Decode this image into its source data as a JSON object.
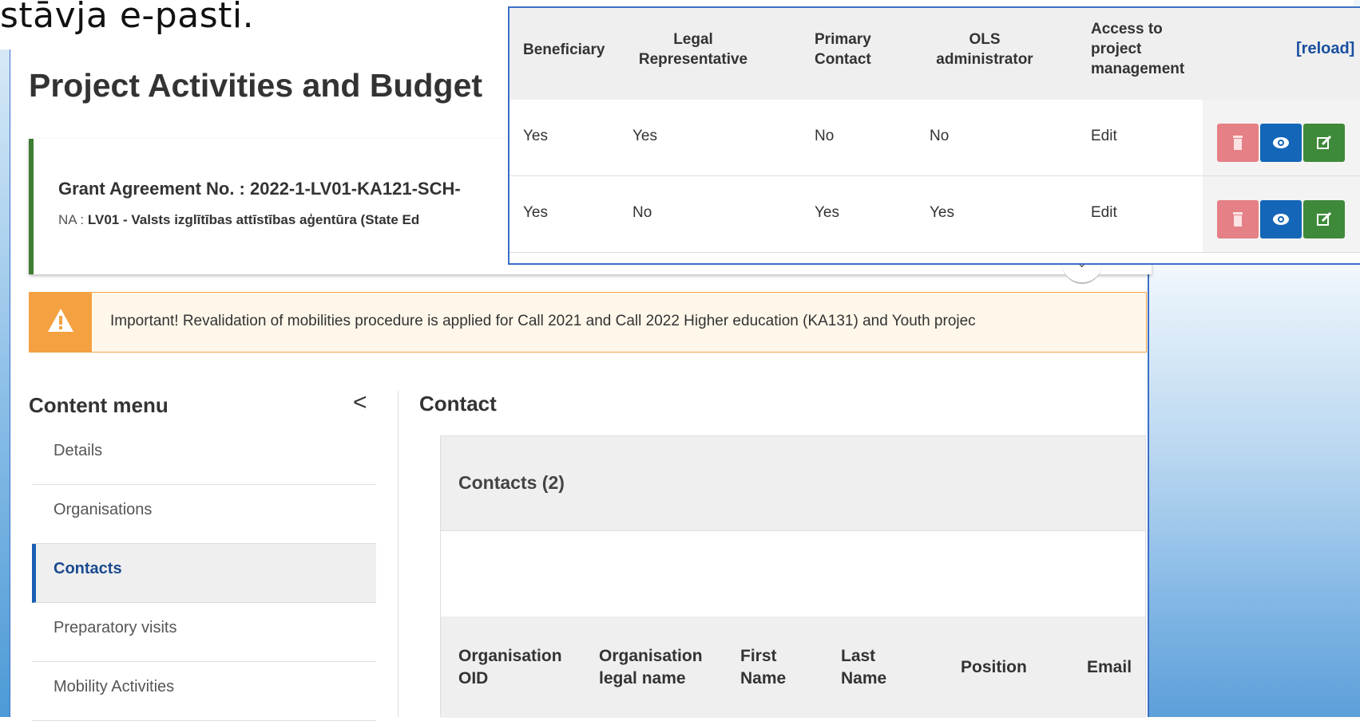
{
  "slide": {
    "title_fragment": "stāvja e-pasti."
  },
  "page": {
    "title": "Project Activities and Budget"
  },
  "grant": {
    "label": "Grant Agreement No. : 2022-1-LV01-KA121-SCH-",
    "na_prefix": "NA : ",
    "na_value": "LV01 - Valsts izglītības attīstības aģentūra (State Ed"
  },
  "warning": {
    "text": "Important! Revalidation of mobilities procedure is applied for Call 2021 and Call 2022 Higher education (KA131) and Youth projec"
  },
  "content_menu": {
    "title": "Content menu",
    "collapse_glyph": "<",
    "items": [
      {
        "label": "Details"
      },
      {
        "label": "Organisations"
      },
      {
        "label": "Contacts"
      },
      {
        "label": "Preparatory visits"
      },
      {
        "label": "Mobility Activities"
      }
    ]
  },
  "contact": {
    "title": "Contact",
    "panel_title": "Contacts (2)",
    "columns": [
      {
        "line1": "Organisation",
        "line2": "OID"
      },
      {
        "line1": "Organisation",
        "line2": "legal name"
      },
      {
        "line1": "First",
        "line2": "Name"
      },
      {
        "line1": "Last",
        "line2": "Name"
      },
      {
        "line1": "Position",
        "line2": ""
      },
      {
        "line1": "Email",
        "line2": ""
      }
    ]
  },
  "popup": {
    "headers": [
      {
        "lines": [
          "Beneficiary"
        ]
      },
      {
        "lines": [
          "Legal",
          "Representative"
        ]
      },
      {
        "lines": [
          "Primary",
          "Contact"
        ]
      },
      {
        "lines": [
          "OLS",
          "administrator"
        ]
      },
      {
        "lines": [
          "Access to",
          "project",
          "management"
        ]
      }
    ],
    "reload_label": "[reload]",
    "rows": [
      {
        "cells": [
          "Yes",
          "Yes",
          "No",
          "No",
          "Edit"
        ]
      },
      {
        "cells": [
          "Yes",
          "No",
          "Yes",
          "Yes",
          "Edit"
        ]
      }
    ]
  },
  "colors": {
    "grant_border": "#3e7d33",
    "warning": "#f4a142",
    "active_menu": "#1a5fb4",
    "btn_delete": "#e58086",
    "btn_view": "#1466b8",
    "btn_edit": "#3e8a3a",
    "reload_link": "#1a4fa0"
  },
  "icons": [
    "warning-icon",
    "chevron-left-icon",
    "chevron-down-icon",
    "trash-icon",
    "eye-icon",
    "edit-icon"
  ]
}
